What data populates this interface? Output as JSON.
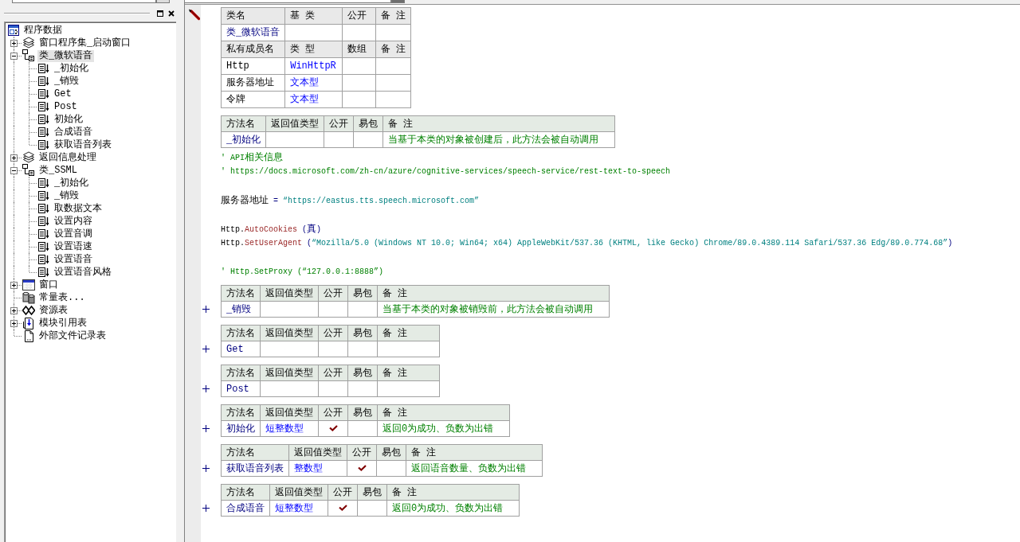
{
  "left_panel": {
    "tree": {
      "label": "程序数据",
      "kind": "root",
      "selected": false,
      "children": [
        {
          "label": "窗口程序集_启动窗口",
          "kind": "assembly",
          "selected": false,
          "expanded": false
        },
        {
          "label": "类_微软语音",
          "kind": "class",
          "selected": true,
          "expanded": true,
          "children": [
            {
              "label": "_初始化",
              "kind": "method",
              "selected": false
            },
            {
              "label": "_销毁",
              "kind": "method",
              "selected": false
            },
            {
              "label": "Get",
              "kind": "method",
              "selected": false
            },
            {
              "label": "Post",
              "kind": "method",
              "selected": false
            },
            {
              "label": "初始化",
              "kind": "method",
              "selected": false
            },
            {
              "label": "合成语音",
              "kind": "method",
              "selected": false
            },
            {
              "label": "获取语音列表",
              "kind": "method",
              "selected": false
            }
          ]
        },
        {
          "label": "返回信息处理",
          "kind": "assembly",
          "selected": false,
          "expanded": false
        },
        {
          "label": "类_SSML",
          "kind": "class",
          "selected": false,
          "expanded": true,
          "children": [
            {
              "label": "_初始化",
              "kind": "method",
              "selected": false
            },
            {
              "label": "_销毁",
              "kind": "method",
              "selected": false
            },
            {
              "label": "取数据文本",
              "kind": "method",
              "selected": false
            },
            {
              "label": "设置内容",
              "kind": "method",
              "selected": false
            },
            {
              "label": "设置音调",
              "kind": "method",
              "selected": false
            },
            {
              "label": "设置语速",
              "kind": "method",
              "selected": false
            },
            {
              "label": "设置语音",
              "kind": "method",
              "selected": false
            },
            {
              "label": "设置语音风格",
              "kind": "method",
              "selected": false
            }
          ]
        },
        {
          "label": "窗口",
          "kind": "window",
          "selected": false,
          "expanded": false
        },
        {
          "label": "常量表...",
          "kind": "constants",
          "selected": false
        },
        {
          "label": "资源表",
          "kind": "resources",
          "selected": false,
          "expanded": false
        },
        {
          "label": "模块引用表",
          "kind": "references",
          "selected": false,
          "expanded": false
        },
        {
          "label": "外部文件记录表",
          "kind": "file",
          "selected": false
        }
      ]
    }
  },
  "editor": {
    "class_table": {
      "columns": [
        "类名",
        "基 类",
        "公开",
        "备 注"
      ],
      "name": "类_微软语音",
      "member_columns": [
        "私有成员名",
        "类 型",
        "数组",
        "备 注"
      ],
      "members": [
        {
          "name": "Http",
          "type": "WinHttpR"
        },
        {
          "name": "服务器地址",
          "type": "文本型"
        },
        {
          "name": "令牌",
          "type": "文本型"
        }
      ]
    },
    "methods": [
      {
        "columns": [
          "方法名",
          "返回值类型",
          "公开",
          "易包",
          "备 注"
        ],
        "name": "_初始化",
        "public": false,
        "remark": "当基于本类的对象被创建后，此方法会被自动调用",
        "expanded": true,
        "body": [
          {
            "lines": [
              {
                "tokens": [
                  {
                    "kind": "comment",
                    "text": "' API相关信息"
                  }
                ]
              },
              {
                "tokens": [
                  {
                    "kind": "comment",
                    "text": "' https://docs.microsoft.com/zh-cn/azure/cognitive-services/speech-service/rest-text-to-speech"
                  }
                ]
              }
            ]
          },
          {
            "lines": [
              {
                "tokens": [
                  {
                    "kind": "plain",
                    "text": "服务器地址 "
                  },
                  {
                    "kind": "operator",
                    "text": "= "
                  },
                  {
                    "kind": "string",
                    "text": "“https://eastus.tts.speech.microsoft.com”"
                  }
                ]
              }
            ]
          },
          {
            "lines": [
              {
                "tokens": [
                  {
                    "kind": "plain",
                    "text": "Http."
                  },
                  {
                    "kind": "method",
                    "text": "AutoCookies"
                  },
                  {
                    "kind": "operator",
                    "text": " (真)"
                  }
                ]
              },
              {
                "tokens": [
                  {
                    "kind": "plain",
                    "text": "Http."
                  },
                  {
                    "kind": "method",
                    "text": "SetUserAgent"
                  },
                  {
                    "kind": "operator",
                    "text": " ("
                  },
                  {
                    "kind": "string",
                    "text": "“Mozilla/5.0 (Windows NT 10.0; Win64; x64) AppleWebKit/537.36 (KHTML, like Gecko) Chrome/89.0.4389.114 Safari/537.36 Edg/89.0.774.68”"
                  },
                  {
                    "kind": "operator",
                    "text": ")"
                  }
                ]
              }
            ]
          },
          {
            "lines": [
              {
                "tokens": [
                  {
                    "kind": "comment",
                    "text": "' Http.SetProxy (“127.0.0.1:8888”)"
                  }
                ]
              }
            ]
          }
        ]
      },
      {
        "columns": [
          "方法名",
          "返回值类型",
          "公开",
          "易包",
          "备 注"
        ],
        "name": "_销毁",
        "public": false,
        "remark": "当基于本类的对象被销毁前，此方法会被自动调用",
        "expanded": false
      },
      {
        "columns": [
          "方法名",
          "返回值类型",
          "公开",
          "易包",
          "备 注"
        ],
        "name": "Get",
        "public": false,
        "expanded": false
      },
      {
        "columns": [
          "方法名",
          "返回值类型",
          "公开",
          "易包",
          "备 注"
        ],
        "name": "Post",
        "public": false,
        "expanded": false
      },
      {
        "columns": [
          "方法名",
          "返回值类型",
          "公开",
          "易包",
          "备 注"
        ],
        "name": "初始化",
        "return_type": "短整数型",
        "public": true,
        "remark": "返回0为成功、负数为出错",
        "expanded": false
      },
      {
        "columns": [
          "方法名",
          "返回值类型",
          "公开",
          "易包",
          "备 注"
        ],
        "name": "获取语音列表",
        "return_type": "整数型",
        "public": true,
        "remark": "返回语音数量、负数为出错",
        "expanded": false
      },
      {
        "columns": [
          "方法名",
          "返回值类型",
          "公开",
          "易包",
          "备 注"
        ],
        "name": "合成语音",
        "return_type": "短整数型",
        "public": true,
        "remark": "返回0为成功、负数为出错",
        "expanded": false
      }
    ]
  }
}
